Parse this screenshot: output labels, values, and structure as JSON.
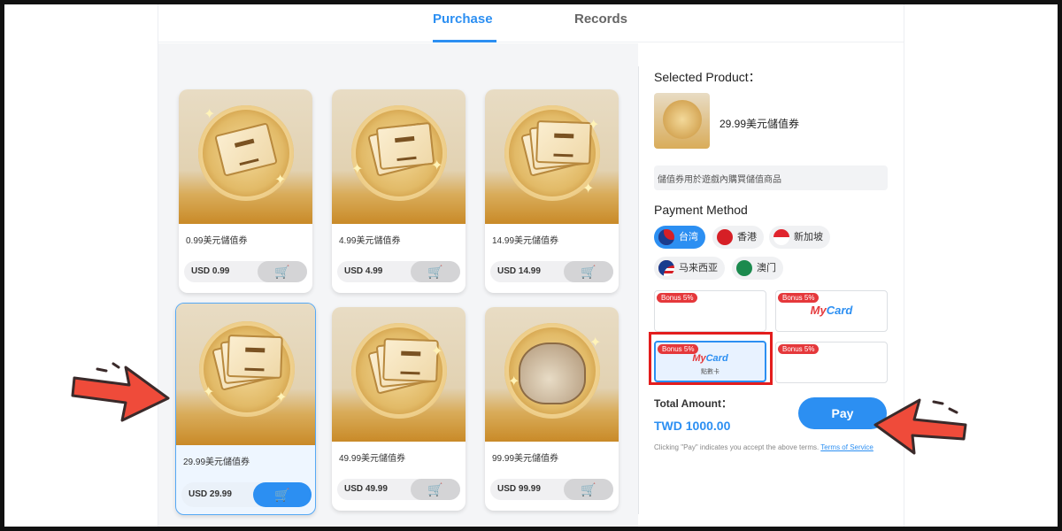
{
  "tabs": [
    {
      "label": "Purchase",
      "active": true
    },
    {
      "label": "Records",
      "active": false
    }
  ],
  "products": [
    {
      "name": "0.99美元儲值券",
      "price": "USD 0.99",
      "art": "single-ticket"
    },
    {
      "name": "4.99美元儲值券",
      "price": "USD 4.99",
      "art": "ticket-stack-small"
    },
    {
      "name": "14.99美元儲值券",
      "price": "USD 14.99",
      "art": "ticket-stack-fan"
    },
    {
      "name": "29.99美元儲值券",
      "price": "USD 29.99",
      "art": "ticket-stack-large",
      "selected": true
    },
    {
      "name": "49.99美元儲值券",
      "price": "USD 49.99",
      "art": "ticket-stack-xl"
    },
    {
      "name": "99.99美元儲值券",
      "price": "USD 99.99",
      "art": "ticket-sack"
    }
  ],
  "side": {
    "selected_title": "Selected Product：",
    "selected_name": "29.99美元儲值券",
    "selected_desc": "儲值券用於遊戲內購買儲值商品",
    "payment_title": "Payment Method",
    "regions": [
      {
        "label": "台湾",
        "active": true,
        "flag_color": "#d61f26"
      },
      {
        "label": "香港",
        "active": false,
        "flag_color": "#d61f26"
      },
      {
        "label": "新加坡",
        "active": false,
        "flag_color": "#e0242d"
      },
      {
        "label": "马来西亚",
        "active": false,
        "flag_color": "#1a3c8e"
      },
      {
        "label": "澳门",
        "active": false,
        "flag_color": "#1b8a4e"
      }
    ],
    "pay_options": [
      {
        "bonus": "Bonus 5%",
        "logo": "",
        "sub": ""
      },
      {
        "bonus": "Bonus 5%",
        "logo": "MyCard",
        "sub": ""
      },
      {
        "bonus": "Bonus 5%",
        "logo": "MyCard",
        "sub": "點數卡",
        "selected": true
      },
      {
        "bonus": "Bonus 5%",
        "logo": "",
        "sub": ""
      }
    ],
    "total_label": "Total Amount：",
    "total_amount": "TWD 1000.00",
    "pay_label": "Pay",
    "terms_text": "Clicking \"Pay\" indicates you accept the above terms.",
    "terms_link": "Terms of Service"
  },
  "colors": {
    "accent": "#2c8ff2",
    "highlight": "#e31d1d",
    "arrow": "#ef4b3a"
  },
  "icons": {
    "cart": "cart-plus-icon",
    "arrow": "pointer-arrow-icon"
  }
}
